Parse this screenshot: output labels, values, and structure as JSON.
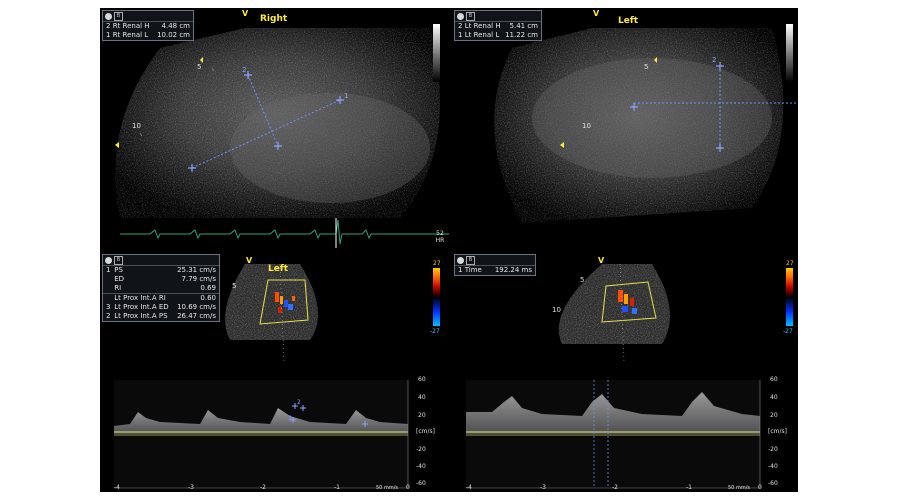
{
  "colors": {
    "ecg": "#2ea37a",
    "caliper": "#6f8fff",
    "sector_outline": "#e8e04a",
    "label_yellow": "#ffeb3b",
    "baseline": "#c8c870"
  },
  "top_left": {
    "title": "Right",
    "v_marker": "V",
    "measurements": [
      {
        "index": "2",
        "label": "Rt Renal H",
        "value": "4.48 cm"
      },
      {
        "index": "1",
        "label": "Rt Renal L",
        "value": "10.02 cm"
      }
    ],
    "depth_labels": [
      "5",
      "10"
    ]
  },
  "top_right": {
    "title": "Left",
    "v_marker": "V",
    "measurements": [
      {
        "index": "2",
        "label": "Lt Renal H",
        "value": "5.41 cm"
      },
      {
        "index": "1",
        "label": "Lt Renal L",
        "value": "11.22 cm"
      }
    ],
    "depth_labels": [
      "5",
      "10"
    ]
  },
  "ecg": {
    "hr_value": "52",
    "hr_label": "HR"
  },
  "bottom_left": {
    "title": "Left",
    "v_marker": "V",
    "measurements": [
      {
        "index": "1",
        "label": "PS",
        "value": "25.31 cm/s"
      },
      {
        "index": "",
        "label": "ED",
        "value": "7.79 cm/s"
      },
      {
        "index": "",
        "label": "RI",
        "value": "0.69"
      },
      {
        "index": "",
        "label": "Lt Prox Int.A RI",
        "value": "0.60"
      },
      {
        "index": "3",
        "label": "Lt Prox Int.A ED",
        "value": "10.69 cm/s"
      },
      {
        "index": "2",
        "label": "Lt Prox Int.A PS",
        "value": "26.47 cm/s"
      }
    ],
    "depth_labels": [
      "5"
    ],
    "color_scale": {
      "top": "27",
      "bottom": "-27"
    },
    "y_ticks": [
      "60",
      "40",
      "20",
      "[cm/s]",
      "-20",
      "-40",
      "-60"
    ],
    "x_ticks": [
      "-4",
      "-3",
      "-2",
      "-1",
      "0"
    ],
    "sweep": "50 mm/s"
  },
  "bottom_right": {
    "v_marker": "V",
    "measurements": [
      {
        "index": "1",
        "label": "Time",
        "value": "192.24 ms"
      }
    ],
    "depth_labels": [
      "5",
      "10"
    ],
    "color_scale": {
      "top": "27",
      "bottom": "-27"
    },
    "y_ticks": [
      "60",
      "40",
      "20",
      "[cm/s]",
      "-20",
      "-40",
      "-60"
    ],
    "x_ticks": [
      "-4",
      "-3",
      "-2",
      "-1",
      "0"
    ],
    "sweep": "50 mm/s"
  }
}
